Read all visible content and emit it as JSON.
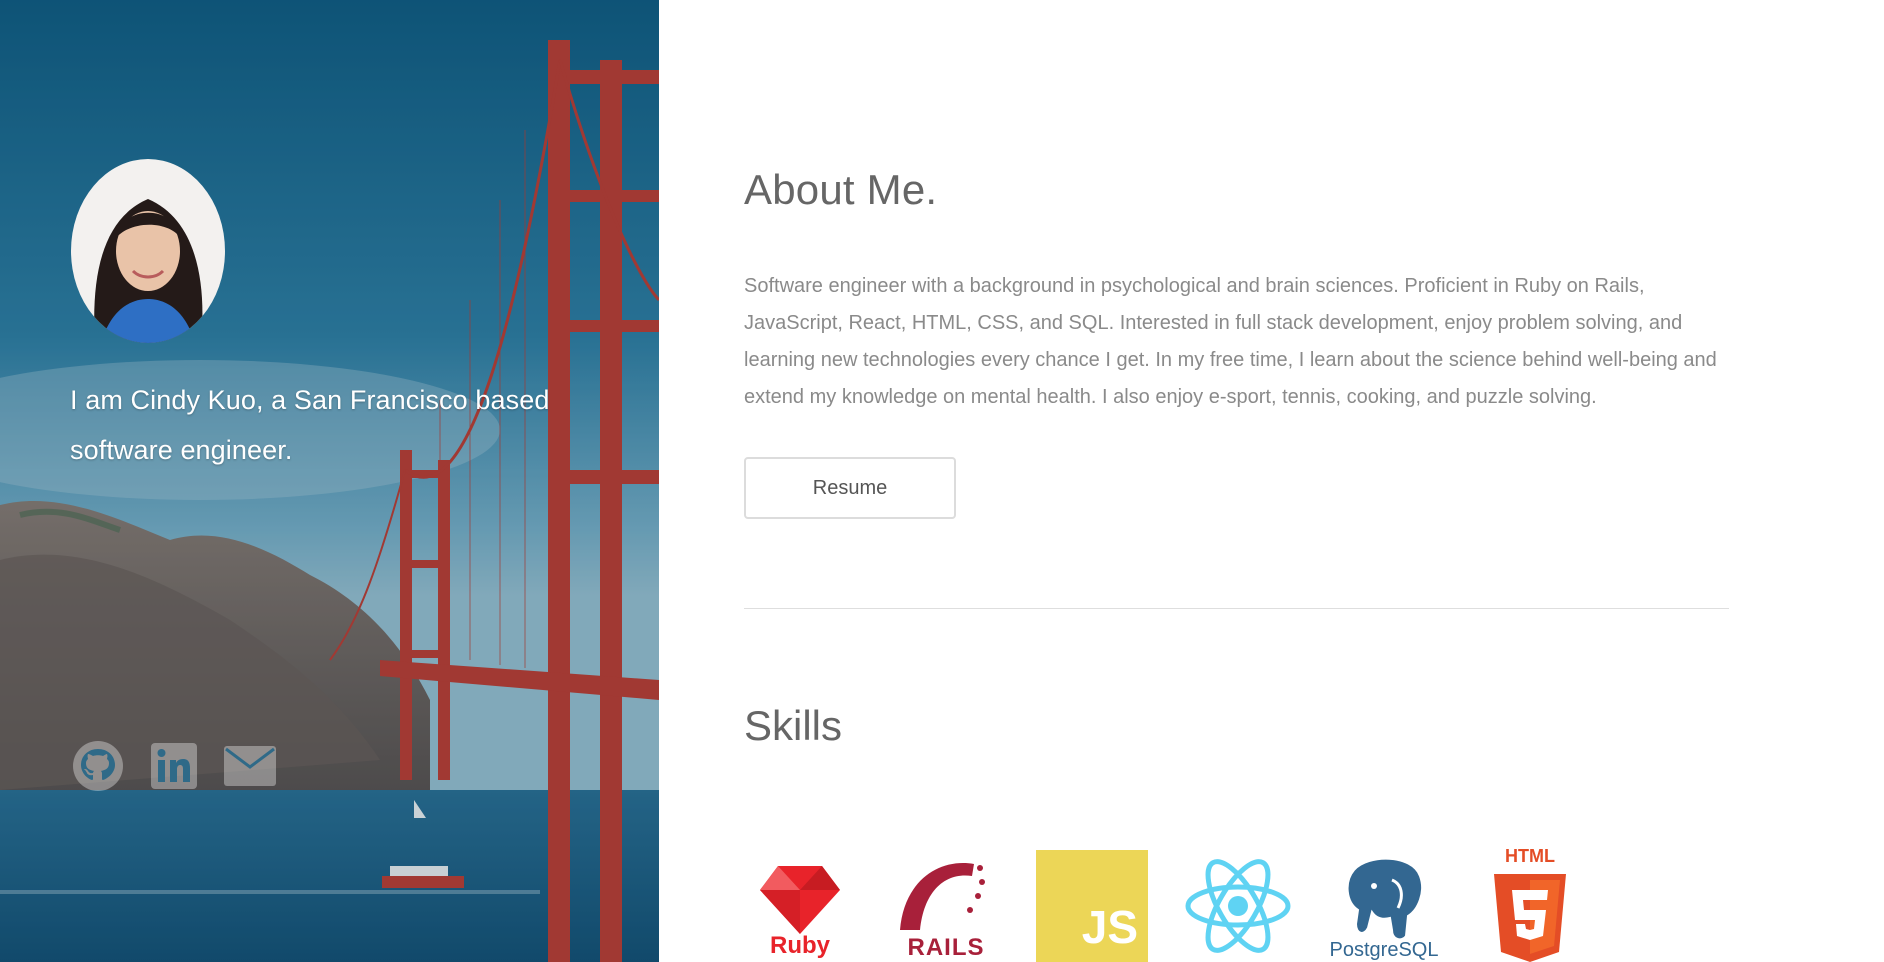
{
  "hero": {
    "intro": "I am Cindy Kuo, a San Francisco based software engineer.",
    "avatar_icon": "profile-photo",
    "social": [
      {
        "name": "github-icon",
        "label": "GitHub"
      },
      {
        "name": "linkedin-icon",
        "label": "LinkedIn"
      },
      {
        "name": "email-icon",
        "label": "Email"
      }
    ]
  },
  "about": {
    "title": "About Me.",
    "text": "Software engineer with a background in psychological and brain sciences. Proficient in Ruby on Rails, JavaScript, React, HTML, CSS, and SQL. Interested in full stack development, enjoy problem solving, and learning new technologies every chance I get. In my free time, I learn about the science behind well-being and extend my knowledge on mental health. I also enjoy e-sport, tennis, cooking, and puzzle solving.",
    "resume_label": "Resume"
  },
  "skills": {
    "title": "Skills",
    "items": [
      {
        "label": "Ruby",
        "icon": "ruby-logo",
        "color": "#e8232a"
      },
      {
        "label": "RAILS",
        "icon": "rails-logo",
        "color": "#a8203a"
      },
      {
        "label": "JS",
        "icon": "javascript-logo",
        "color": "#ecd657"
      },
      {
        "label": "",
        "icon": "react-logo",
        "color": "#5fd3f3"
      },
      {
        "label": "PostgreSQL",
        "icon": "postgresql-logo",
        "color": "#336791"
      },
      {
        "label": "HTML",
        "icon": "html5-logo",
        "color": "#e44d26"
      }
    ]
  },
  "colors": {
    "sky_top": "#0f5c82",
    "water": "#1c5f86",
    "bridge": "#c23a2e",
    "text_gray": "#8a8a8a",
    "heading_gray": "#666666"
  }
}
